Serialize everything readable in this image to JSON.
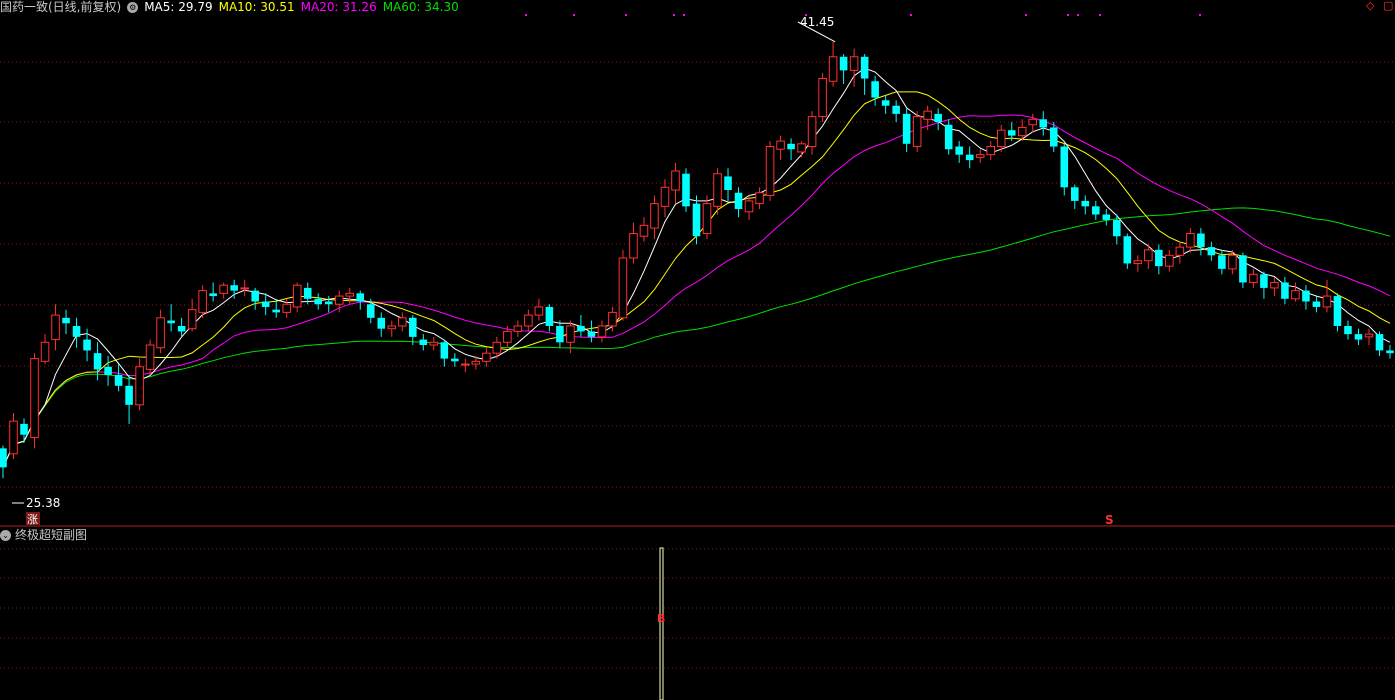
{
  "header": {
    "title": "国药一致(日线,前复权)",
    "ma5": "MA5: 29.79",
    "ma10": "MA10: 30.51",
    "ma20": "MA20: 31.26",
    "ma60": "MA60: 34.30"
  },
  "sub_panel": {
    "title": "终极超短副图"
  },
  "annotations": {
    "high_label": "41.45",
    "low_label": "25.38",
    "rise_badge": "涨",
    "signal_mark": "S",
    "sub_signal_mark": "B"
  },
  "colors": {
    "up": "#ff3030",
    "down": "#00ffff",
    "ma5": "#ffffff",
    "ma10": "#ffff00",
    "ma20": "#ff00ff",
    "ma60": "#00e000",
    "grid": "#8b1a1a"
  },
  "chart_data": {
    "type": "candlestick",
    "price_range": [
      24.6,
      42.4
    ],
    "candles": [
      [
        26.5,
        25.8,
        26.6,
        25.4
      ],
      [
        26.3,
        27.5,
        27.8,
        26.1
      ],
      [
        27.4,
        27.0,
        27.6,
        26.7
      ],
      [
        26.9,
        29.8,
        30.0,
        26.5
      ],
      [
        29.7,
        30.4,
        30.7,
        29.6
      ],
      [
        30.5,
        31.4,
        31.8,
        30.1
      ],
      [
        31.3,
        31.1,
        31.6,
        30.7
      ],
      [
        31.0,
        30.6,
        31.3,
        30.2
      ],
      [
        30.5,
        30.1,
        30.9,
        29.7
      ],
      [
        30.0,
        29.4,
        30.4,
        29.0
      ],
      [
        29.5,
        29.2,
        29.9,
        28.8
      ],
      [
        29.2,
        28.8,
        29.6,
        28.6
      ],
      [
        28.8,
        28.1,
        29.2,
        27.4
      ],
      [
        28.1,
        29.5,
        29.8,
        27.9
      ],
      [
        29.4,
        30.3,
        30.5,
        29.2
      ],
      [
        30.2,
        31.3,
        31.6,
        30.0
      ],
      [
        31.2,
        31.1,
        31.8,
        30.8
      ],
      [
        31.0,
        30.8,
        31.3,
        30.6
      ],
      [
        30.9,
        31.6,
        32.0,
        30.8
      ],
      [
        31.5,
        32.3,
        32.5,
        31.3
      ],
      [
        32.2,
        32.1,
        32.6,
        31.9
      ],
      [
        32.2,
        32.5,
        32.6,
        32.0
      ],
      [
        32.5,
        32.3,
        32.7,
        32.0
      ],
      [
        32.4,
        32.4,
        32.7,
        32.1
      ],
      [
        32.3,
        31.9,
        32.4,
        31.6
      ],
      [
        31.9,
        31.7,
        32.2,
        31.4
      ],
      [
        31.6,
        31.5,
        32.0,
        31.3
      ],
      [
        31.5,
        31.8,
        32.0,
        31.3
      ],
      [
        31.7,
        32.5,
        32.6,
        31.5
      ],
      [
        32.4,
        32.0,
        32.6,
        31.8
      ],
      [
        32.0,
        31.8,
        32.2,
        31.6
      ],
      [
        31.9,
        31.8,
        32.1,
        31.5
      ],
      [
        31.8,
        32.1,
        32.3,
        31.5
      ],
      [
        32.1,
        32.2,
        32.4,
        31.8
      ],
      [
        32.2,
        31.9,
        32.3,
        31.6
      ],
      [
        31.8,
        31.3,
        32.0,
        31.1
      ],
      [
        31.3,
        30.9,
        31.5,
        30.6
      ],
      [
        30.9,
        31.0,
        31.2,
        30.6
      ],
      [
        31.0,
        31.3,
        31.5,
        30.8
      ],
      [
        31.3,
        30.6,
        31.4,
        30.3
      ],
      [
        30.5,
        30.3,
        30.7,
        30.1
      ],
      [
        30.3,
        30.4,
        30.6,
        30.1
      ],
      [
        30.4,
        29.8,
        30.5,
        29.5
      ],
      [
        29.8,
        29.7,
        30.0,
        29.5
      ],
      [
        29.6,
        29.6,
        29.8,
        29.3
      ],
      [
        29.6,
        29.7,
        29.9,
        29.4
      ],
      [
        29.7,
        30.0,
        30.2,
        29.5
      ],
      [
        30.0,
        30.4,
        30.6,
        29.8
      ],
      [
        30.4,
        30.8,
        31.0,
        30.2
      ],
      [
        30.8,
        31.0,
        31.2,
        30.6
      ],
      [
        31.0,
        31.4,
        31.6,
        30.8
      ],
      [
        31.4,
        31.7,
        32.0,
        31.2
      ],
      [
        31.7,
        31.0,
        31.8,
        30.8
      ],
      [
        31.0,
        30.4,
        31.2,
        30.2
      ],
      [
        30.4,
        31.0,
        31.2,
        30.0
      ],
      [
        31.0,
        30.8,
        31.4,
        30.6
      ],
      [
        30.8,
        30.6,
        31.2,
        30.4
      ],
      [
        30.6,
        31.0,
        31.2,
        30.4
      ],
      [
        31.0,
        31.5,
        31.7,
        30.8
      ],
      [
        31.3,
        33.5,
        33.8,
        31.2
      ],
      [
        33.5,
        34.4,
        34.8,
        33.3
      ],
      [
        34.3,
        34.7,
        35.0,
        34.1
      ],
      [
        34.6,
        35.5,
        35.8,
        34.2
      ],
      [
        35.4,
        36.1,
        36.4,
        35.0
      ],
      [
        36.0,
        36.7,
        37.0,
        35.5
      ],
      [
        36.6,
        35.4,
        36.8,
        35.2
      ],
      [
        35.5,
        34.3,
        35.8,
        34.0
      ],
      [
        34.4,
        35.5,
        35.8,
        34.2
      ],
      [
        35.4,
        36.6,
        36.8,
        35.1
      ],
      [
        36.5,
        36.0,
        36.8,
        35.6
      ],
      [
        35.9,
        35.3,
        36.1,
        35.0
      ],
      [
        35.2,
        35.6,
        35.8,
        34.9
      ],
      [
        35.5,
        35.9,
        36.1,
        35.3
      ],
      [
        35.8,
        37.6,
        37.8,
        35.6
      ],
      [
        37.5,
        37.8,
        38.0,
        37.1
      ],
      [
        37.7,
        37.5,
        37.9,
        37.1
      ],
      [
        37.4,
        37.7,
        37.8,
        37.2
      ],
      [
        37.6,
        38.7,
        38.9,
        37.3
      ],
      [
        38.7,
        40.1,
        40.3,
        38.5
      ],
      [
        40.0,
        40.9,
        41.45,
        39.8
      ],
      [
        40.9,
        40.4,
        41.0,
        39.9
      ],
      [
        40.4,
        40.9,
        41.2,
        39.8
      ],
      [
        40.9,
        40.1,
        41.0,
        39.5
      ],
      [
        40.0,
        39.4,
        40.2,
        39.1
      ],
      [
        39.3,
        39.1,
        39.5,
        38.8
      ],
      [
        39.1,
        38.8,
        39.3,
        38.5
      ],
      [
        38.8,
        37.7,
        39.0,
        37.4
      ],
      [
        37.6,
        38.7,
        38.9,
        37.4
      ],
      [
        38.6,
        38.9,
        39.1,
        38.2
      ],
      [
        38.8,
        38.5,
        39.0,
        38.2
      ],
      [
        38.4,
        37.5,
        38.6,
        37.3
      ],
      [
        37.6,
        37.3,
        37.8,
        37.0
      ],
      [
        37.3,
        37.1,
        37.6,
        36.8
      ],
      [
        37.2,
        37.3,
        37.5,
        37.0
      ],
      [
        37.3,
        37.6,
        37.8,
        37.1
      ],
      [
        37.6,
        38.2,
        38.4,
        37.4
      ],
      [
        38.2,
        38.0,
        38.5,
        37.8
      ],
      [
        38.0,
        38.3,
        38.6,
        37.8
      ],
      [
        38.4,
        38.6,
        38.8,
        38.1
      ],
      [
        38.6,
        38.3,
        38.9,
        38.0
      ],
      [
        38.3,
        37.6,
        38.5,
        37.4
      ],
      [
        37.6,
        36.1,
        37.7,
        35.8
      ],
      [
        36.1,
        35.6,
        36.2,
        35.3
      ],
      [
        35.6,
        35.4,
        35.8,
        35.1
      ],
      [
        35.4,
        35.1,
        35.6,
        34.9
      ],
      [
        35.1,
        34.9,
        35.3,
        34.7
      ],
      [
        34.9,
        34.3,
        35.1,
        34.0
      ],
      [
        34.3,
        33.3,
        34.4,
        33.1
      ],
      [
        33.3,
        33.4,
        33.6,
        33.0
      ],
      [
        33.4,
        33.8,
        34.0,
        33.1
      ],
      [
        33.8,
        33.2,
        34.0,
        32.9
      ],
      [
        33.2,
        33.6,
        33.8,
        33.0
      ],
      [
        33.6,
        33.9,
        34.1,
        33.3
      ],
      [
        33.9,
        34.4,
        34.6,
        33.7
      ],
      [
        34.4,
        33.9,
        34.6,
        33.6
      ],
      [
        33.9,
        33.6,
        34.1,
        33.4
      ],
      [
        33.6,
        33.1,
        33.8,
        32.9
      ],
      [
        33.1,
        33.6,
        33.8,
        32.9
      ],
      [
        33.6,
        32.6,
        33.7,
        32.4
      ],
      [
        32.6,
        32.9,
        33.1,
        32.4
      ],
      [
        32.9,
        32.4,
        33.0,
        32.0
      ],
      [
        32.4,
        32.6,
        32.8,
        32.1
      ],
      [
        32.6,
        32.0,
        32.8,
        31.8
      ],
      [
        32.0,
        32.3,
        32.6,
        31.9
      ],
      [
        32.3,
        31.9,
        32.5,
        31.6
      ],
      [
        31.9,
        31.7,
        32.1,
        31.5
      ],
      [
        31.7,
        32.1,
        32.7,
        31.5
      ],
      [
        32.1,
        31.0,
        32.2,
        30.8
      ],
      [
        31.0,
        30.7,
        31.2,
        30.5
      ],
      [
        30.7,
        30.5,
        30.9,
        30.3
      ],
      [
        30.6,
        30.7,
        30.9,
        30.3
      ],
      [
        30.7,
        30.1,
        30.8,
        29.9
      ],
      [
        30.1,
        30.0,
        30.3,
        29.8
      ]
    ],
    "ma5_last": 29.79,
    "ma10_last": 30.51,
    "ma20_last": 31.26,
    "ma60_last": 34.3,
    "high": 41.45,
    "low": 25.38
  }
}
